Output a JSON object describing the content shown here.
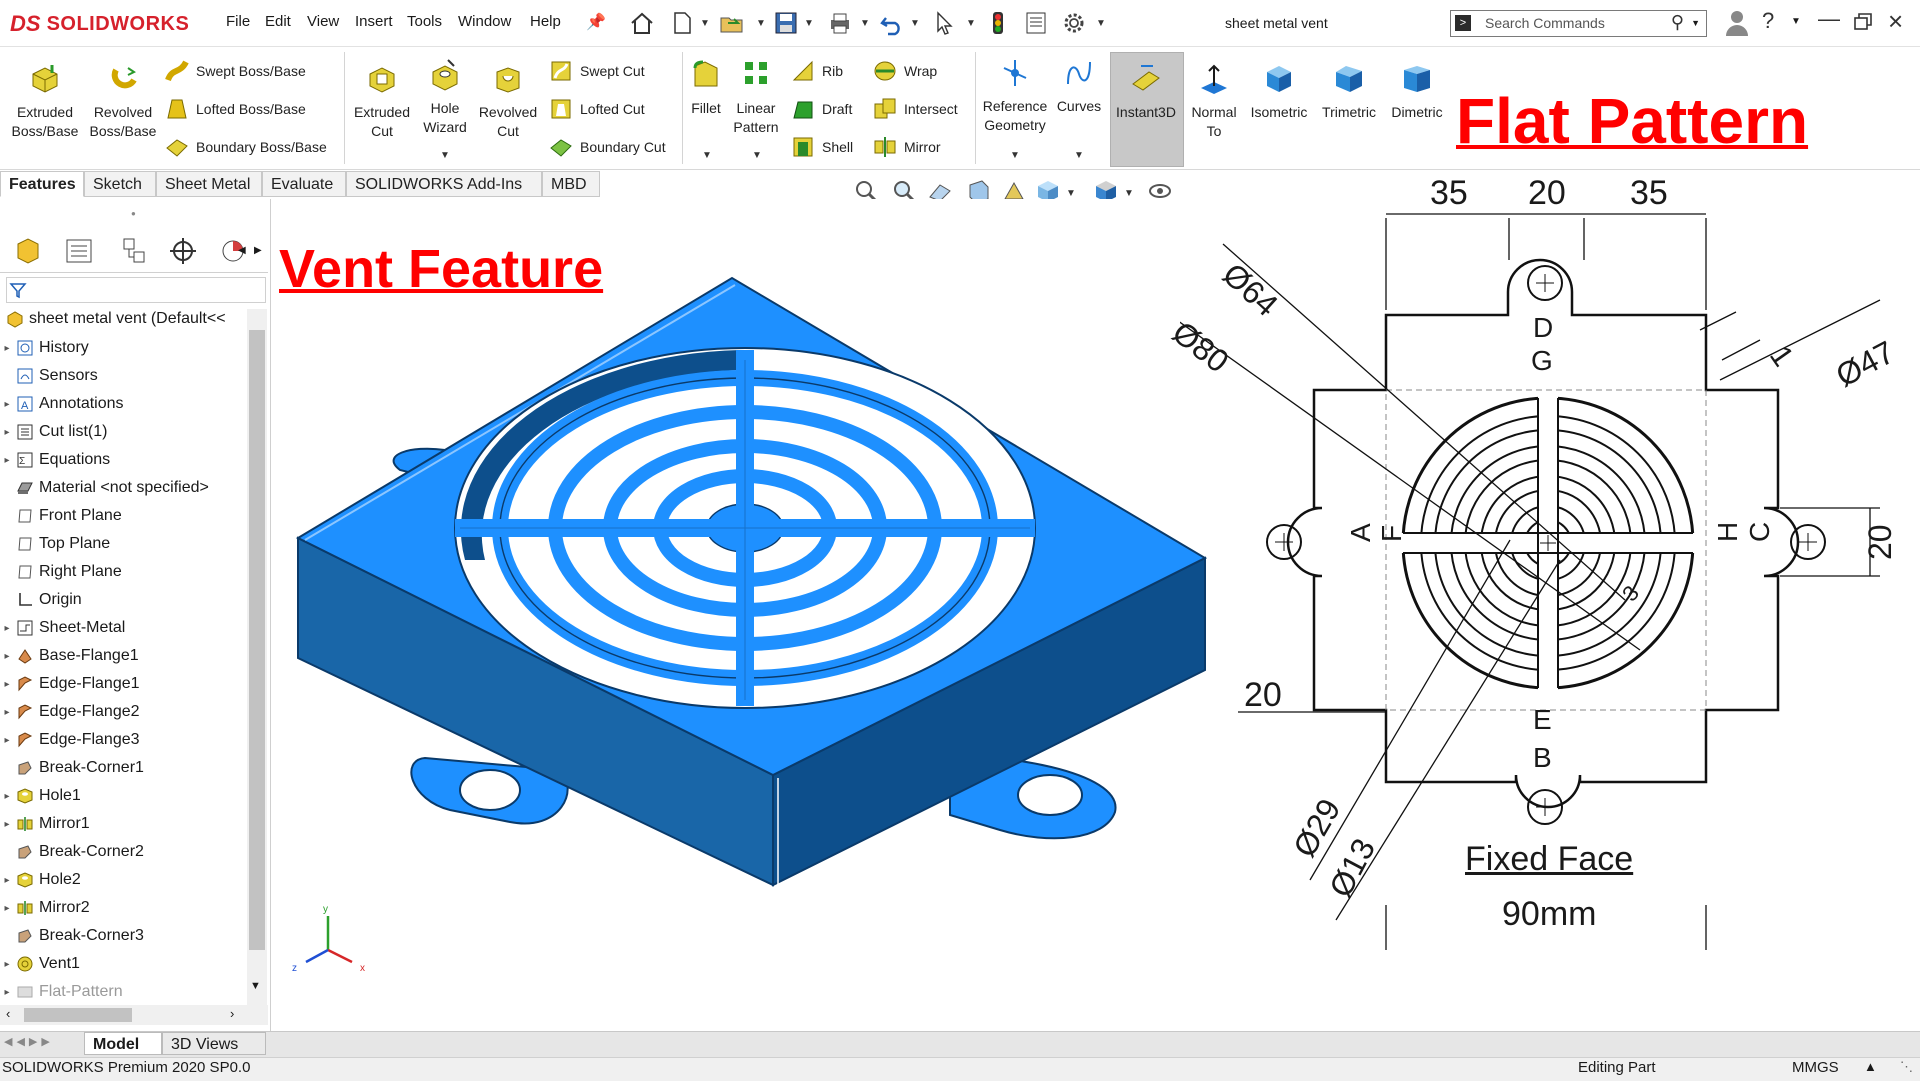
{
  "app": {
    "logo_ds": "DS",
    "logo_text": "SOLIDWORKS",
    "document_title": "sheet metal vent",
    "search_placeholder": "Search Commands"
  },
  "menu": [
    "File",
    "Edit",
    "View",
    "Insert",
    "Tools",
    "Window",
    "Help"
  ],
  "commands": {
    "extruded_boss": "Extruded\nBoss/Base",
    "revolved_boss": "Revolved\nBoss/Base",
    "swept_boss": "Swept Boss/Base",
    "lofted_boss": "Lofted Boss/Base",
    "boundary_boss": "Boundary Boss/Base",
    "extruded_cut": "Extruded\nCut",
    "hole_wizard": "Hole\nWizard",
    "revolved_cut": "Revolved\nCut",
    "swept_cut": "Swept Cut",
    "lofted_cut": "Lofted Cut",
    "boundary_cut": "Boundary Cut",
    "fillet": "Fillet",
    "linear_pattern": "Linear\nPattern",
    "rib": "Rib",
    "draft": "Draft",
    "shell": "Shell",
    "wrap": "Wrap",
    "intersect": "Intersect",
    "mirror": "Mirror",
    "reference_geometry": "Reference\nGeometry",
    "curves": "Curves",
    "instant3d": "Instant3D",
    "normal_to": "Normal\nTo",
    "isometric": "Isometric",
    "trimetric": "Trimetric",
    "dimetric": "Dimetric"
  },
  "tabs": [
    "Features",
    "Sketch",
    "Sheet Metal",
    "Evaluate",
    "SOLIDWORKS Add-Ins",
    "MBD"
  ],
  "tree": {
    "root": "sheet metal vent  (Default<<",
    "items": [
      "History",
      "Sensors",
      "Annotations",
      "Cut list(1)",
      "Equations",
      "Material <not specified>",
      "Front Plane",
      "Top Plane",
      "Right Plane",
      "Origin",
      "Sheet-Metal",
      "Base-Flange1",
      "Edge-Flange1",
      "Edge-Flange2",
      "Edge-Flange3",
      "Break-Corner1",
      "Hole1",
      "Mirror1",
      "Break-Corner2",
      "Hole2",
      "Mirror2",
      "Break-Corner3",
      "Vent1",
      "Flat-Pattern"
    ]
  },
  "overlay": {
    "vent_title": "Vent Feature",
    "flat_title": "Flat Pattern"
  },
  "drawing": {
    "dim_35a": "35",
    "dim_20_top": "20",
    "dim_35b": "35",
    "dim_64": "Ø64",
    "dim_80": "Ø80",
    "dim_1": "1",
    "dim_47": "Ø47",
    "dim_20_right": "20",
    "dim_20_left": "20",
    "dim_29": "Ø29",
    "dim_13": "Ø13",
    "dim_90": "90mm",
    "fixed_face": "Fixed Face",
    "dim_small": "3",
    "lbl_D": "D",
    "lbl_G": "G",
    "lbl_A": "A",
    "lbl_F": "F",
    "lbl_H": "H",
    "lbl_C": "C",
    "lbl_E": "E",
    "lbl_B": "B"
  },
  "triad": {
    "x": "x",
    "y": "y",
    "z": "z"
  },
  "bottom_tabs": [
    "Model",
    "3D Views"
  ],
  "status": {
    "product": "SOLIDWORKS Premium 2020 SP0.0",
    "mode": "Editing Part",
    "units": "MMGS"
  },
  "colors": {
    "part_blue": "#1e90ff",
    "part_dark": "#0a5a9c",
    "accent_red": "#ff0000",
    "brand_red": "#d6212c"
  }
}
